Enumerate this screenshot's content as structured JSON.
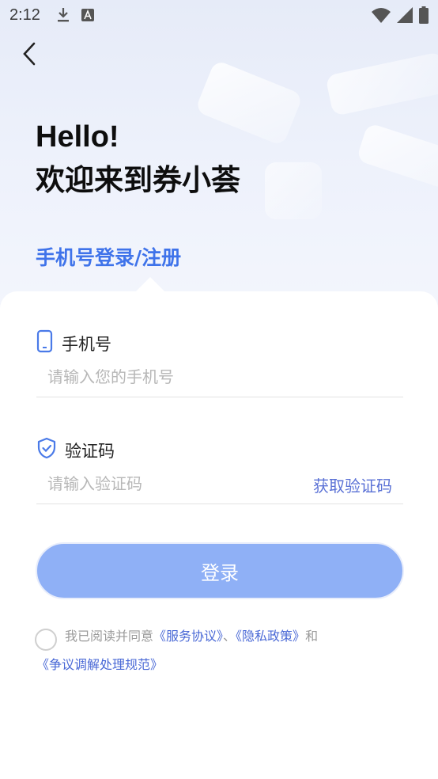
{
  "status_bar": {
    "time": "2:12",
    "left_icons": [
      "download-icon",
      "font-icon"
    ],
    "right_icons": [
      "wifi-icon",
      "signal-icon",
      "battery-icon"
    ]
  },
  "header": {
    "back_icon": "chevron-left-icon",
    "greeting": "Hello!",
    "welcome": "欢迎来到券小荟"
  },
  "tab": {
    "title": "手机号登录/注册"
  },
  "phone_field": {
    "label": "手机号",
    "icon": "phone-icon",
    "placeholder": "请输入您的手机号",
    "value": ""
  },
  "code_field": {
    "label": "验证码",
    "icon": "shield-check-icon",
    "placeholder": "请输入验证码",
    "value": "",
    "get_code_label": "获取验证码"
  },
  "login_button": {
    "label": "登录"
  },
  "agreement": {
    "prefix": "我已阅读并同意",
    "link1": "《服务协议》",
    "sep": "、",
    "link2": "《隐私政策》",
    "and": "和",
    "link3": "《争议调解处理规范》",
    "checked": false
  },
  "colors": {
    "accent": "#3f73ea",
    "button_bg": "#8fb0f6",
    "link": "#4a69d6",
    "placeholder": "#b7b7b7"
  }
}
